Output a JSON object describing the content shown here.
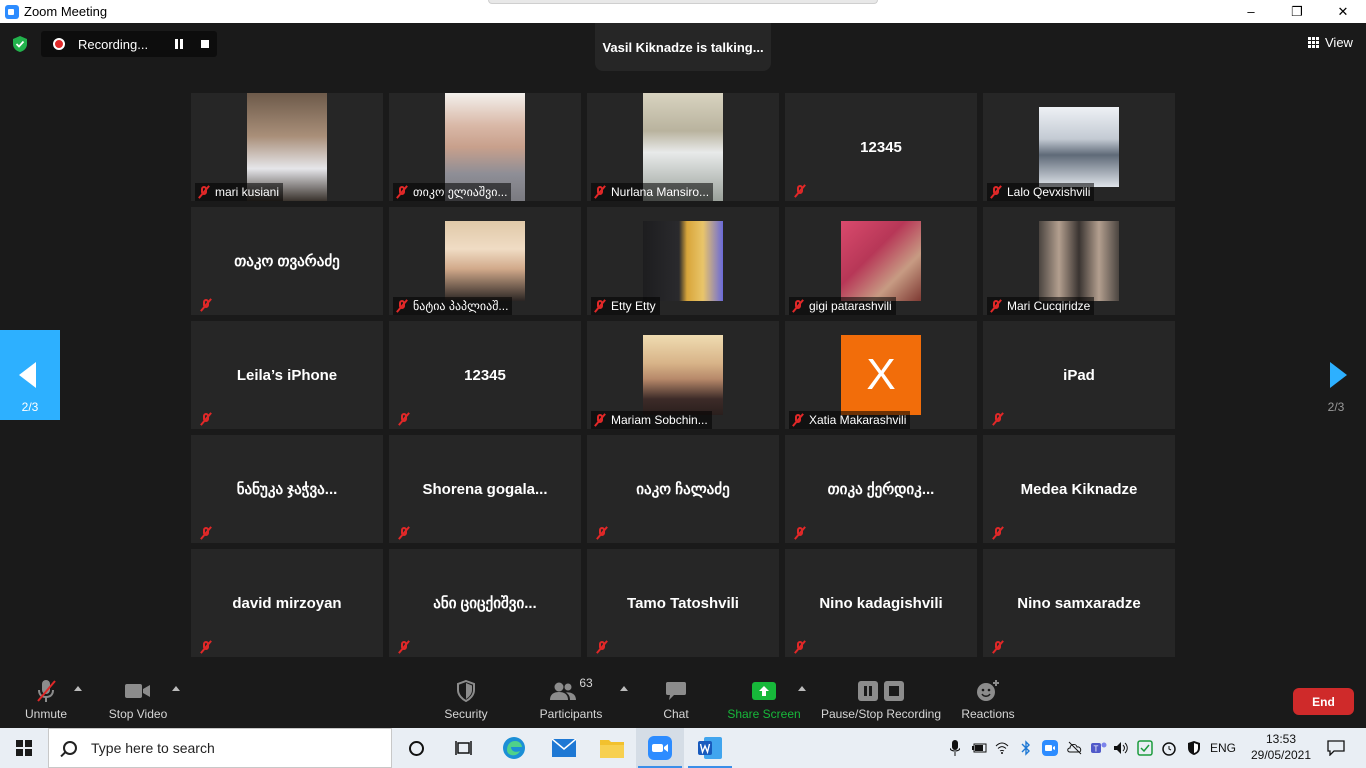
{
  "window": {
    "title": "Zoom Meeting",
    "controls": [
      "–",
      "❐",
      "✕"
    ]
  },
  "meeting": {
    "recording_label": "Recording...",
    "talking": "Vasil Kiknadze is talking...",
    "view_label": "View",
    "page_indicator_left": "2/3",
    "page_indicator_right": "2/3",
    "tiles": [
      {
        "name": "mari kusiani",
        "video": true
      },
      {
        "name": "თიკო ელიაშვი...",
        "video": true
      },
      {
        "name": "Nurlana Mansiro...",
        "video": true
      },
      {
        "name": "12345",
        "video": false
      },
      {
        "name": "Lalo Qevxishvili",
        "video": true
      },
      {
        "name": "თაკო თვარაძე",
        "video": false
      },
      {
        "name": "ნატია პაპლიაშ...",
        "video": true
      },
      {
        "name": "Etty Etty",
        "video": true
      },
      {
        "name": "gigi patarashvili",
        "video": true
      },
      {
        "name": "Mari Cucqiridze",
        "video": true
      },
      {
        "name": "Leila’s iPhone",
        "video": false
      },
      {
        "name": "12345",
        "video": false
      },
      {
        "name": "Mariam Sobchin...",
        "video": true
      },
      {
        "name": "Xatia Makarashvili",
        "video": true,
        "avatar_letter": "X"
      },
      {
        "name": "iPad",
        "video": false
      },
      {
        "name": "ნანუკა ჯაჭვა...",
        "video": false
      },
      {
        "name": "Shorena gogala...",
        "video": false
      },
      {
        "name": "იაკო ჩალაძე",
        "video": false
      },
      {
        "name": "თიკა ქერდიკ...",
        "video": false
      },
      {
        "name": "Medea Kiknadze",
        "video": false
      },
      {
        "name": "david mirzoyan",
        "video": false
      },
      {
        "name": "ანი ციცქიშვი...",
        "video": false
      },
      {
        "name": "Tamo Tatoshvili",
        "video": false
      },
      {
        "name": "Nino kadagishvili",
        "video": false
      },
      {
        "name": "Nino samxaradze",
        "video": false
      }
    ]
  },
  "toolbar": {
    "unmute": "Unmute",
    "stop_video": "Stop Video",
    "security": "Security",
    "participants": "Participants",
    "participants_count": "63",
    "chat": "Chat",
    "share_screen": "Share Screen",
    "pause_stop_recording": "Pause/Stop Recording",
    "reactions": "Reactions",
    "end": "End"
  },
  "taskbar": {
    "search_placeholder": "Type here to search",
    "language": "ENG",
    "time": "13:53",
    "date": "29/05/2021"
  },
  "colors": {
    "accent_blue": "#2db0ff",
    "share_green": "#17b83a",
    "end_red": "#cf2a2a",
    "mute_red": "#e02828",
    "tile_bg": "#262626",
    "xatia_avatar": "#f26d0a"
  }
}
